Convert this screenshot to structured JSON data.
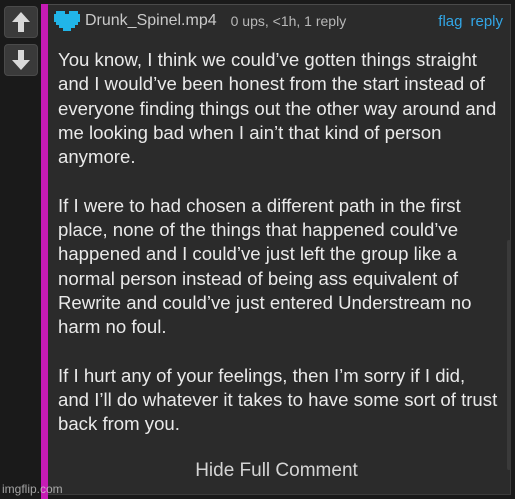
{
  "vote": {
    "up_icon": "arrow-up-icon",
    "down_icon": "arrow-down-icon"
  },
  "comment": {
    "accent_color": "#c51bb4",
    "avatar_icon": "heart-icon",
    "avatar_color": "#21b5e8",
    "username": "Drunk_Spinel.mp4",
    "meta": "0 ups, <1h, 1 reply",
    "actions": {
      "flag": "flag",
      "reply": "reply"
    },
    "link_color": "#32a6e6",
    "paragraphs": [
      "You know, I think we could’ve gotten things straight and I would’ve been honest from the start instead of everyone finding things out the other way around and me looking bad when I ain’t that kind of person anymore.",
      "If I were to had chosen a different path in the first place, none of the things that happened could’ve happened and I could’ve just left the group like a normal person instead of being ass equivalent of Rewrite and could’ve just entered Understream no harm no foul.",
      "If I hurt any of your feelings, then I’m sorry if I did, and I’ll do whatever it takes to have some sort of trust back from you."
    ],
    "toggle_label": "Hide Full Comment"
  },
  "watermark": "imgflip.com"
}
